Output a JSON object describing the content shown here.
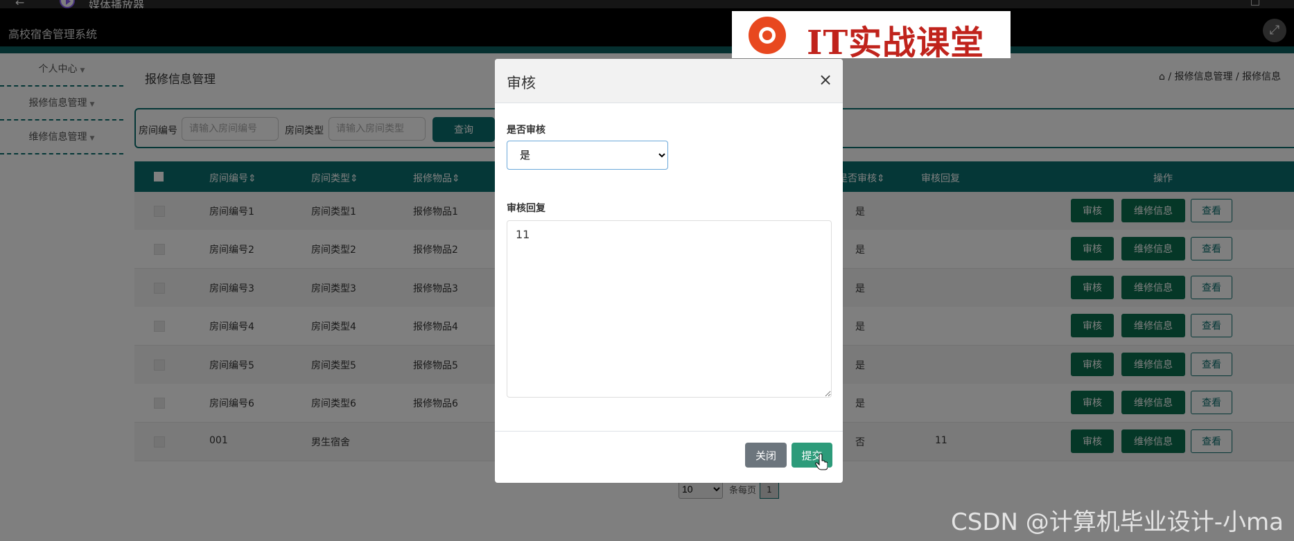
{
  "player": {
    "title": "媒体播放器",
    "back_icon": "←",
    "minimize_icon": "—"
  },
  "app": {
    "system_name": "高校宿舍管理系统",
    "fullscreen_icon": "⤢"
  },
  "watermark_logo": {
    "text": "IT实战课堂"
  },
  "sidebar": {
    "items": [
      {
        "label": "个人中心",
        "caret": "▼"
      },
      {
        "label": "报修信息管理",
        "caret": "▼"
      },
      {
        "label": "维修信息管理",
        "caret": "▼"
      }
    ]
  },
  "page": {
    "title": "报修信息管理"
  },
  "breadcrumb": {
    "home_icon": "⌂",
    "text": "/ 报修信息管理 / 报修信息"
  },
  "search": {
    "room_no_label": "房间编号",
    "room_no_placeholder": "请输入房间编号",
    "room_type_label": "房间类型",
    "room_type_placeholder": "请输入房间类型",
    "query_button": "查询"
  },
  "table": {
    "headers": {
      "room_no": "房间编号⇕",
      "room_type": "房间类型⇕",
      "item": "报修物品⇕",
      "is_audit": "是否审核⇕",
      "reply": "审核回复",
      "actions": "操作"
    },
    "rows": [
      {
        "room_no": "房间编号1",
        "room_type": "房间类型1",
        "item": "报修物品1",
        "is_audit": "是",
        "reply": ""
      },
      {
        "room_no": "房间编号2",
        "room_type": "房间类型2",
        "item": "报修物品2",
        "is_audit": "是",
        "reply": ""
      },
      {
        "room_no": "房间编号3",
        "room_type": "房间类型3",
        "item": "报修物品3",
        "is_audit": "是",
        "reply": ""
      },
      {
        "room_no": "房间编号4",
        "room_type": "房间类型4",
        "item": "报修物品4",
        "is_audit": "是",
        "reply": ""
      },
      {
        "room_no": "房间编号5",
        "room_type": "房间类型5",
        "item": "报修物品5",
        "is_audit": "是",
        "reply": ""
      },
      {
        "room_no": "房间编号6",
        "room_type": "房间类型6",
        "item": "报修物品6",
        "is_audit": "是",
        "reply": ""
      },
      {
        "room_no": "001",
        "room_type": "男生宿舍",
        "item": "",
        "is_audit": "否",
        "reply": "11"
      }
    ],
    "action_labels": {
      "audit": "审核",
      "repair_info": "维修信息",
      "view": "查看"
    }
  },
  "pagination": {
    "page_size": "10",
    "per_page_label": "条每页",
    "current_page": "1"
  },
  "modal": {
    "title": "审核",
    "close_icon": "×",
    "audit_label": "是否审核",
    "audit_value": "是",
    "reply_label": "审核回复",
    "reply_value": "11",
    "close_button": "关闭",
    "submit_button": "提交"
  },
  "csdn_watermark": "CSDN @计算机毕业设计-小ma",
  "colors": {
    "primary_teal": "#0b6f6f",
    "button_green": "#0b6f4f",
    "submit_green": "#2d9b7a",
    "close_gray": "#6c757d"
  }
}
